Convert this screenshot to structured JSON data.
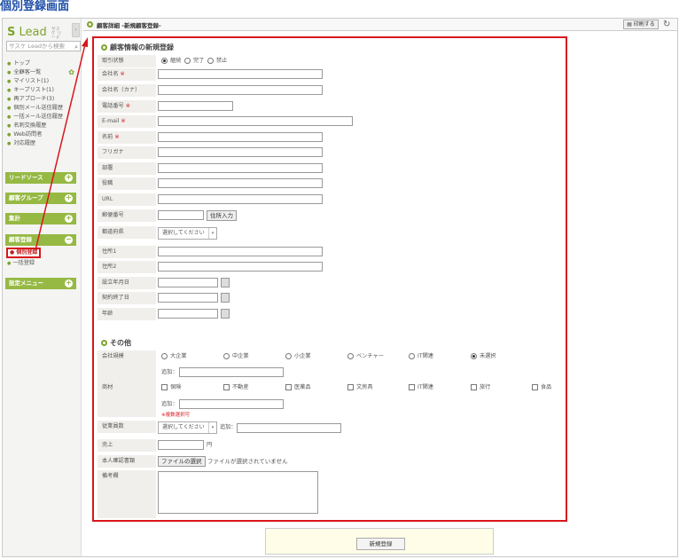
{
  "page_title": "個別登録画面",
  "sidebar": {
    "logo": "Lead",
    "logo_sub": "サスケ リード",
    "search_placeholder": "サスケ Leadから検索",
    "items": [
      "トップ",
      "全顧客一覧",
      "マイリスト(1)",
      "キープリスト(1)",
      "再アプローチ(3)",
      "個別メール送信履歴",
      "一括メール送信履歴",
      "名刺交換履歴",
      "Web訪問者",
      "対応履歴"
    ],
    "sections": [
      "リードソース",
      "顧客グループ",
      "集計",
      "顧客登録",
      "設定メニュー"
    ],
    "register_items": [
      "個別登録",
      "一括登録"
    ]
  },
  "header": {
    "title": "顧客詳細 -新規顧客登録-",
    "print": "印刷する"
  },
  "form": {
    "section1": "顧客情報の新規登録",
    "status_label": "取引状態",
    "status_options": [
      "継続",
      "完了",
      "禁止"
    ],
    "fields": {
      "company": "会社名",
      "company_kana": "会社名（カナ）",
      "phone": "電話番号",
      "email": "E-mail",
      "name": "名前",
      "furigana": "フリガナ",
      "dept": "部署",
      "position": "役職",
      "url": "URL",
      "zip": "郵便番号",
      "pref": "都道府県",
      "addr1": "住所1",
      "addr2": "住所2",
      "founded": "設立年月日",
      "contract_end": "契約終了日",
      "age": "年齢"
    },
    "req_mark": "※",
    "address_btn": "住所入力",
    "select_placeholder": "選択してください",
    "section2": "その他",
    "size_label": "会社規模",
    "size_options": [
      "大企業",
      "中企業",
      "小企業",
      "ベンチャー",
      "IT関連",
      "未選択"
    ],
    "add_label": "追加：",
    "industry_label": "商材",
    "industry_options": [
      "保険",
      "不動産",
      "医薬品",
      "文房具",
      "IT関連",
      "旅行",
      "食品"
    ],
    "industry_hint": "※複数選択可",
    "employees_label": "従業員数",
    "sales_label": "売上",
    "yen": "円",
    "id_label": "本人確認書類",
    "file_btn": "ファイルの選択",
    "file_none": "ファイルが選択されていません",
    "notes_label": "備考欄",
    "submit": "新規登録"
  },
  "colors": {
    "accent": "#96b944",
    "highlight": "#d8161b",
    "title": "#1f4fa8"
  }
}
